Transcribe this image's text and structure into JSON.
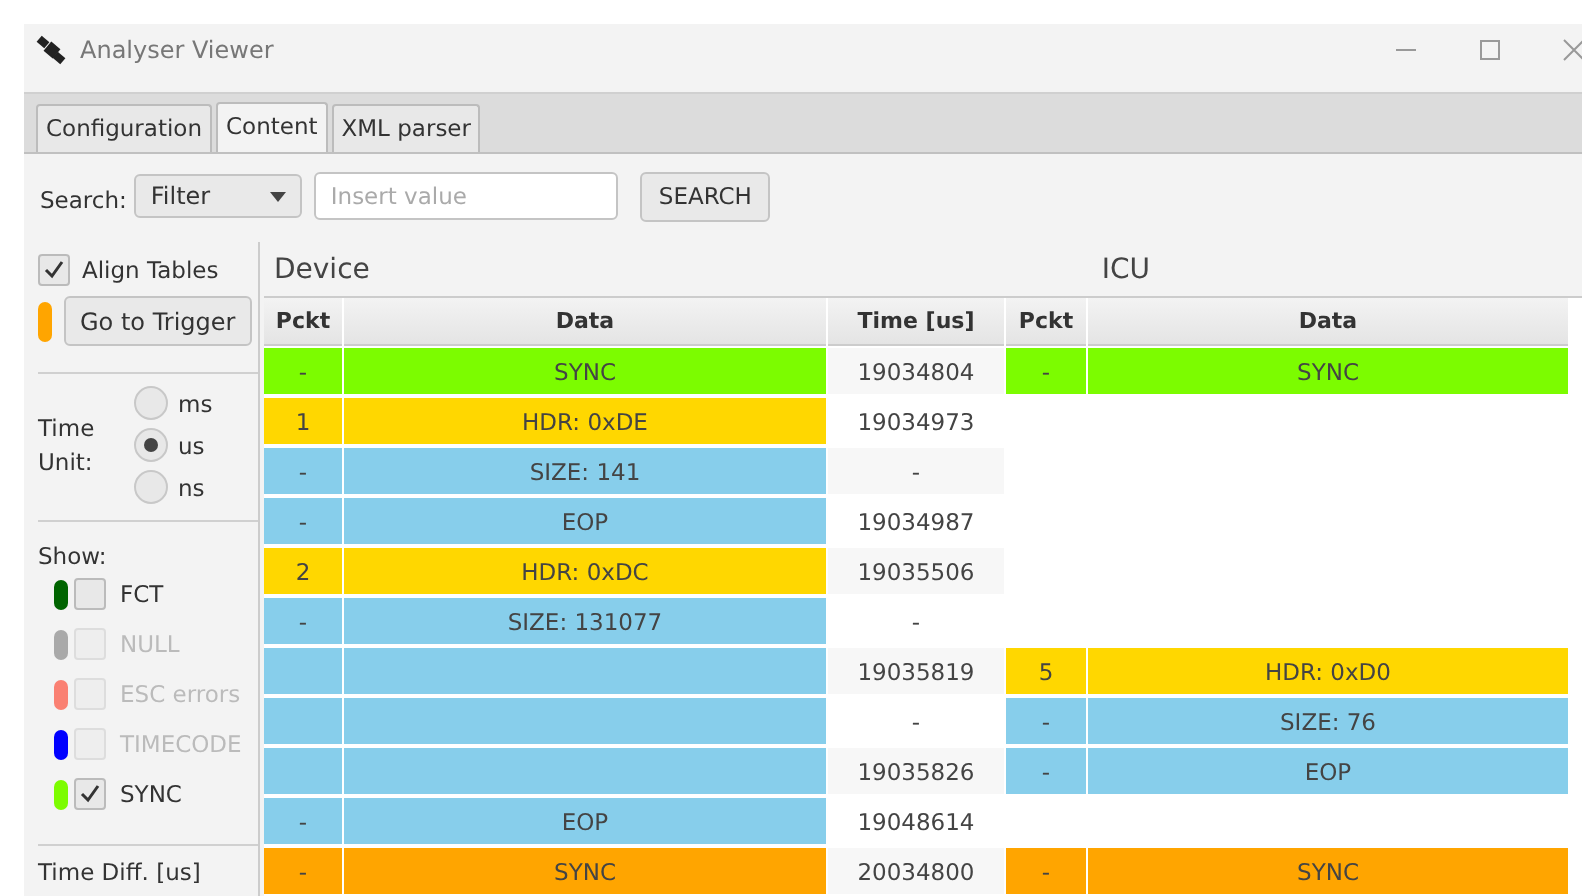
{
  "window": {
    "title": "Analyser Viewer"
  },
  "tabs": [
    {
      "label": "Configuration",
      "selected": false
    },
    {
      "label": "Content",
      "selected": true
    },
    {
      "label": "XML parser",
      "selected": false
    }
  ],
  "search": {
    "label": "Search:",
    "filter": "Filter",
    "placeholder": "Insert value",
    "button": "SEARCH"
  },
  "sidebar": {
    "align_tables": {
      "label": "Align Tables",
      "checked": true
    },
    "trigger_button": {
      "label": "Go to Trigger",
      "color": "#ffa500"
    },
    "time_unit": {
      "label": "Time Unit:",
      "options": [
        {
          "label": "ms",
          "selected": false
        },
        {
          "label": "us",
          "selected": true
        },
        {
          "label": "ns",
          "selected": false
        }
      ]
    },
    "show": {
      "label": "Show:",
      "items": [
        {
          "label": "FCT",
          "color": "#006400",
          "checked": false,
          "disabled": false
        },
        {
          "label": "NULL",
          "color": "#a9a9a9",
          "checked": false,
          "disabled": true
        },
        {
          "label": "ESC errors",
          "color": "#fa8072",
          "checked": false,
          "disabled": true
        },
        {
          "label": "TIMECODE",
          "color": "#0000ff",
          "checked": false,
          "disabled": true
        },
        {
          "label": "SYNC",
          "color": "#7cfc00",
          "checked": true,
          "disabled": false
        }
      ]
    },
    "time_diff": {
      "label": "Time Diff. [us]"
    }
  },
  "table": {
    "device_title": "Device",
    "icu_title": "ICU",
    "columns": [
      "Pckt",
      "Data",
      "Time [us]",
      "Pckt",
      "Data"
    ],
    "rows": [
      {
        "device": {
          "pckt": "-",
          "data": "SYNC",
          "color": "#7cfc00"
        },
        "time": "19034804",
        "icu": {
          "pckt": "-",
          "data": "SYNC",
          "color": "#7cfc00"
        }
      },
      {
        "device": {
          "pckt": "1",
          "data": "HDR: 0xDE",
          "color": "#ffd700"
        },
        "time": "19034973"
      },
      {
        "device": {
          "pckt": "-",
          "data": "SIZE: 141",
          "color": "#87ceeb"
        },
        "time": "-"
      },
      {
        "device": {
          "pckt": "-",
          "data": "EOP",
          "color": "#87ceeb"
        },
        "time": "19034987"
      },
      {
        "device": {
          "pckt": "2",
          "data": "HDR: 0xDC",
          "color": "#ffd700"
        },
        "time": "19035506"
      },
      {
        "device": {
          "pckt": "-",
          "data": "SIZE: 131077",
          "color": "#87ceeb"
        },
        "time": "-"
      },
      {
        "device": {
          "color": "#87ceeb"
        },
        "time": "19035819",
        "icu": {
          "pckt": "5",
          "data": "HDR: 0xD0",
          "color": "#ffd700"
        }
      },
      {
        "device": {
          "color": "#87ceeb"
        },
        "time": "-",
        "icu": {
          "pckt": "-",
          "data": "SIZE: 76",
          "color": "#87ceeb"
        }
      },
      {
        "device": {
          "color": "#87ceeb"
        },
        "time": "19035826",
        "icu": {
          "pckt": "-",
          "data": "EOP",
          "color": "#87ceeb"
        }
      },
      {
        "device": {
          "pckt": "-",
          "data": "EOP",
          "color": "#87ceeb"
        },
        "time": "19048614"
      },
      {
        "device": {
          "pckt": "-",
          "data": "SYNC",
          "color": "#ffa500"
        },
        "time": "20034800",
        "icu": {
          "pckt": "-",
          "data": "SYNC",
          "color": "#ffa500"
        }
      }
    ]
  }
}
